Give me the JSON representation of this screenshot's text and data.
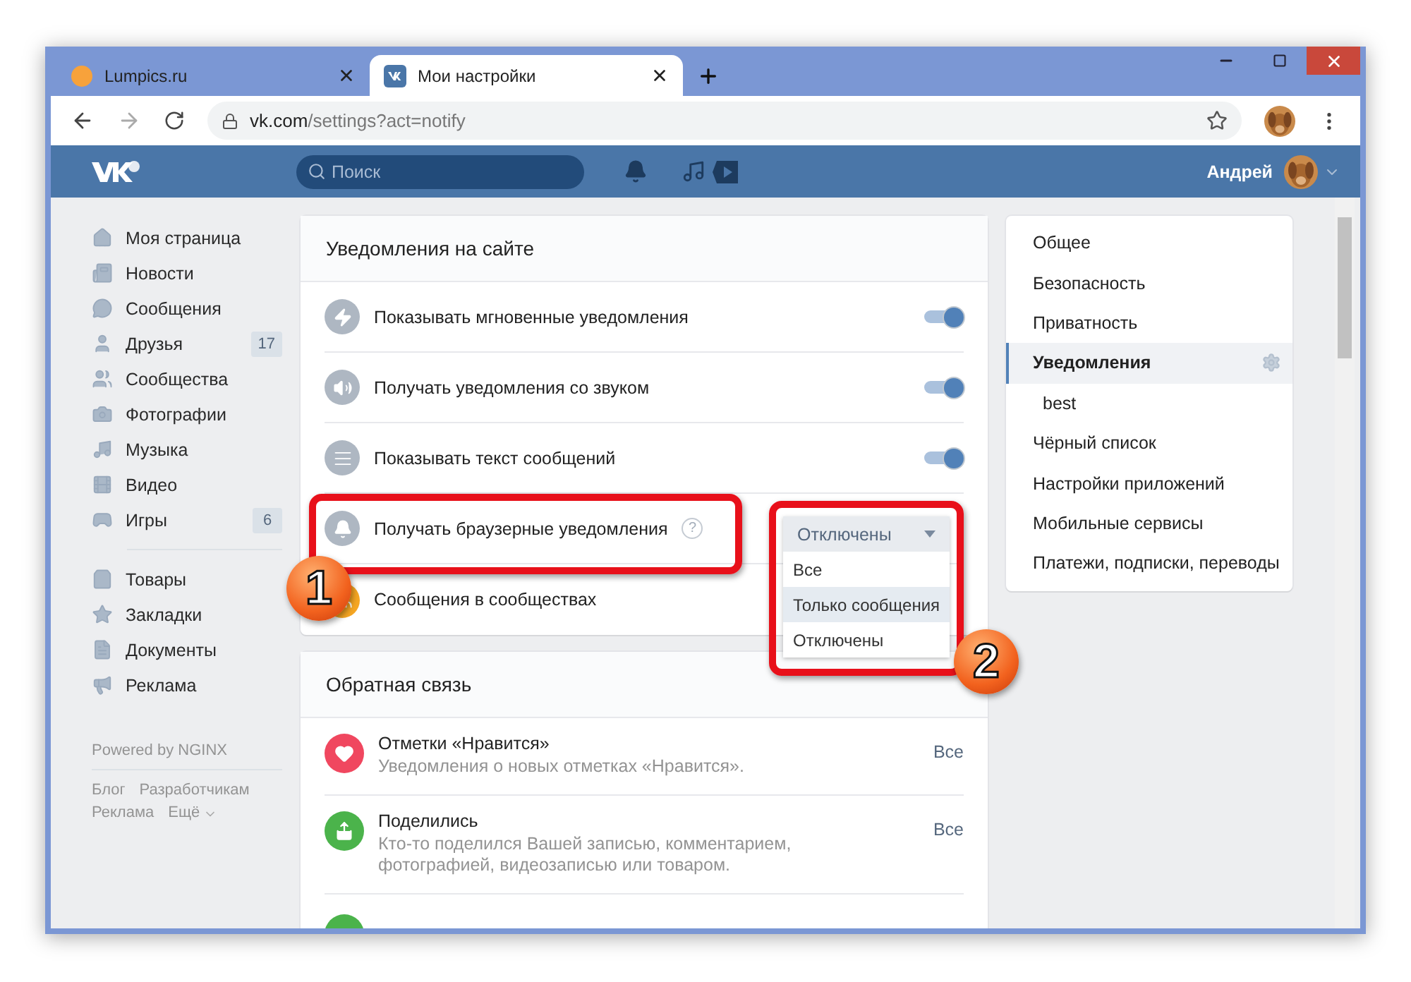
{
  "browser": {
    "tabs": [
      {
        "title": "Lumpics.ru",
        "selected": false
      },
      {
        "title": "Мои настройки",
        "selected": true
      }
    ],
    "url": "vk.com/settings?act=notify"
  },
  "header": {
    "search_placeholder": "Поиск",
    "user_name": "Андрей"
  },
  "sidebar": {
    "groups": [
      {
        "items": [
          {
            "label": "Моя страница"
          },
          {
            "label": "Новости"
          },
          {
            "label": "Сообщения"
          },
          {
            "label": "Друзья",
            "badge": "17"
          },
          {
            "label": "Сообщества"
          },
          {
            "label": "Фотографии"
          },
          {
            "label": "Музыка"
          },
          {
            "label": "Видео"
          },
          {
            "label": "Игры",
            "badge": "6"
          }
        ]
      },
      {
        "items": [
          {
            "label": "Товары"
          },
          {
            "label": "Закладки"
          },
          {
            "label": "Документы"
          },
          {
            "label": "Реклама"
          }
        ]
      }
    ],
    "powered": "Powered by NGINX",
    "links": [
      "Блог",
      "Разработчикам",
      "Реклама",
      "Ещё"
    ]
  },
  "site_notifications": {
    "title": "Уведомления на сайте",
    "rows": [
      {
        "kind": "toggle",
        "label": "Показывать мгновенные уведомления",
        "on": true
      },
      {
        "kind": "toggle",
        "label": "Получать уведомления со звуком",
        "on": true
      },
      {
        "kind": "toggle",
        "label": "Показывать текст сообщений",
        "on": true
      },
      {
        "kind": "select",
        "label": "Получать браузерные уведомления",
        "help": "?",
        "value": "Отключены",
        "expanded": true,
        "options": [
          {
            "label": "Все",
            "highlighted": false
          },
          {
            "label": "Только сообщения",
            "highlighted": true
          },
          {
            "label": "Отключены",
            "highlighted": false
          }
        ]
      },
      {
        "kind": "plain",
        "label": "Сообщения в сообществах"
      }
    ]
  },
  "feedback": {
    "title": "Обратная связь",
    "rows": [
      {
        "title": "Отметки «Нравится»",
        "description": "Уведомления о новых отметках «Нравится».",
        "value": "Все"
      },
      {
        "title": "Поделились",
        "description": "Кто-то поделился Вашей записью, комментарием, фотографией, видеозаписью или товаром.",
        "value": "Все"
      }
    ]
  },
  "settings_menu": {
    "items": [
      {
        "label": "Общее",
        "selected": false
      },
      {
        "label": "Безопасность",
        "selected": false
      },
      {
        "label": "Приватность",
        "selected": false
      },
      {
        "label": "Уведомления",
        "selected": true,
        "children": [
          {
            "label": "best",
            "selected": false
          }
        ]
      },
      {
        "label": "Чёрный список",
        "selected": false
      },
      {
        "label": "Настройки приложений",
        "selected": false
      },
      {
        "label": "Мобильные сервисы",
        "selected": false
      },
      {
        "label": "Платежи, подписки, переводы",
        "selected": false
      }
    ]
  },
  "annotations": [
    {
      "label": "1"
    },
    {
      "label": "2"
    }
  ]
}
